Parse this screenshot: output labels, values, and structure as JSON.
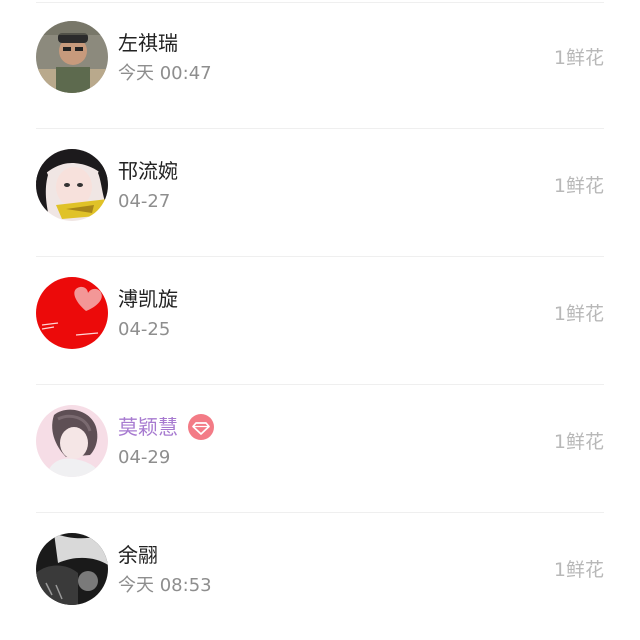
{
  "contacts": [
    {
      "name": "左祺瑞",
      "time": "今天 00:47",
      "flowers": "1鲜花",
      "vip": false
    },
    {
      "name": "邗流婉",
      "time": "04-27",
      "flowers": "1鲜花",
      "vip": false
    },
    {
      "name": "溥凯旋",
      "time": "04-25",
      "flowers": "1鲜花",
      "vip": false
    },
    {
      "name": "莫颖慧",
      "time": "04-29",
      "flowers": "1鲜花",
      "vip": true
    },
    {
      "name": "余翮",
      "time": "今天 08:53",
      "flowers": "1鲜花",
      "vip": false
    }
  ],
  "icons": {
    "vip_badge": "diamond-icon"
  },
  "colors": {
    "vip_name": "#a77ad0",
    "vip_badge": "#f37b86",
    "flower_text": "#b8b8b8",
    "date_text": "#8e8e8e"
  }
}
